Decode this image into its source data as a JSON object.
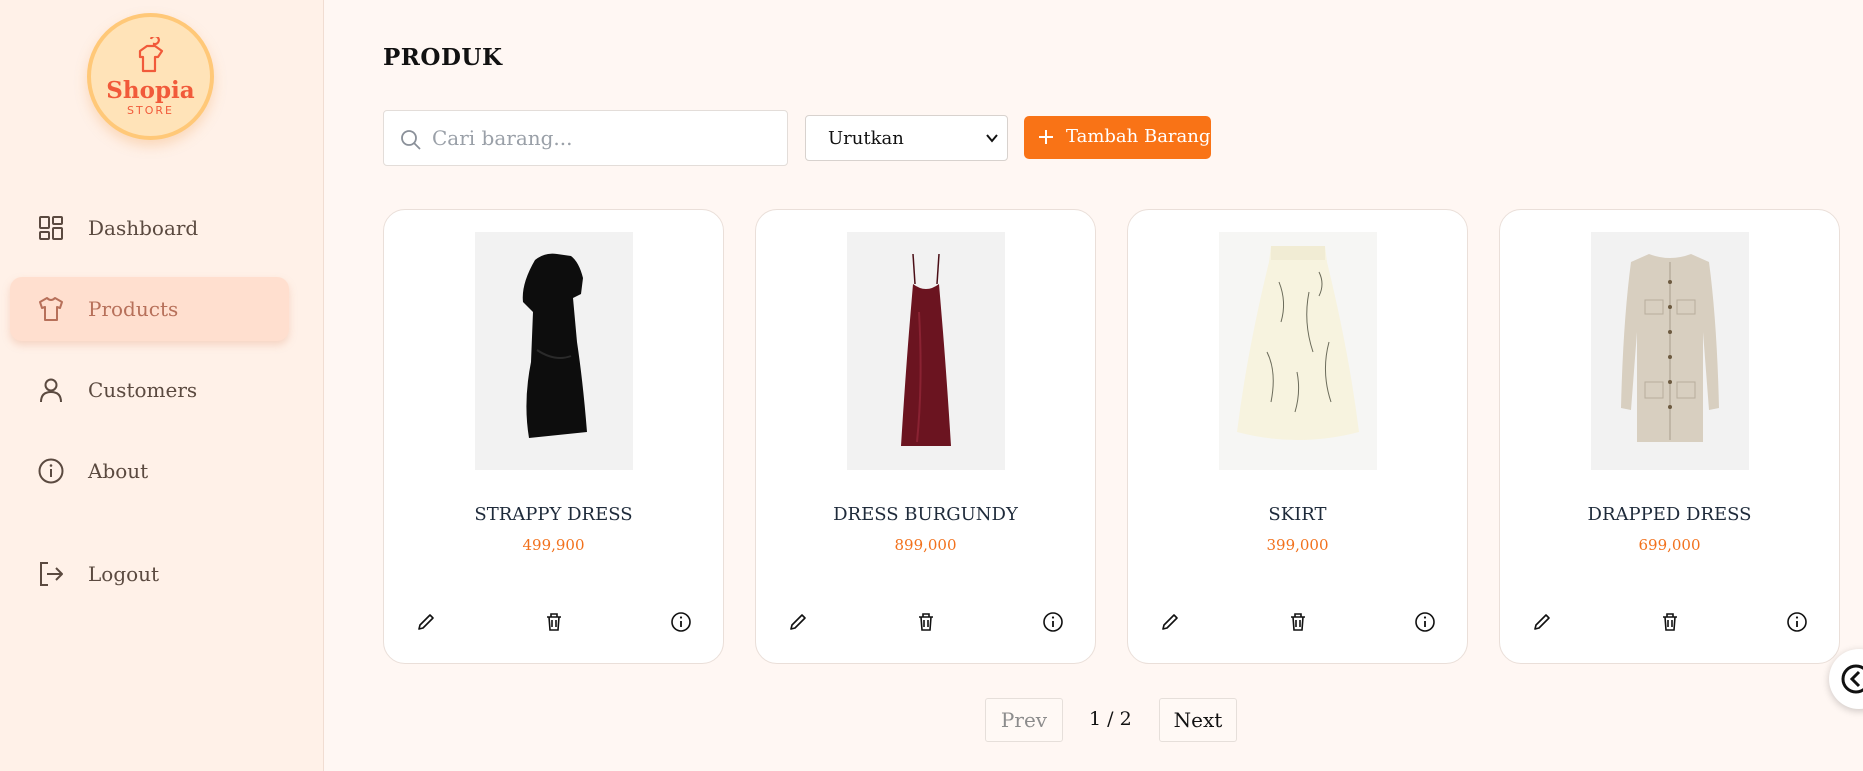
{
  "brand": {
    "name": "Shopia",
    "sub": "STORE",
    "accent": "#f15a3a"
  },
  "sidebar": {
    "items": [
      {
        "label": "Dashboard",
        "icon": "dashboard-grid-icon",
        "active": false
      },
      {
        "label": "Products",
        "icon": "tshirt-icon",
        "active": true
      },
      {
        "label": "Customers",
        "icon": "user-icon",
        "active": false
      },
      {
        "label": "About",
        "icon": "info-icon",
        "active": false
      },
      {
        "label": "Logout",
        "icon": "logout-icon",
        "active": false
      }
    ]
  },
  "main": {
    "title": "PRODUK",
    "search": {
      "placeholder": "Cari barang...",
      "value": ""
    },
    "sort": {
      "selected": "Urutkan"
    },
    "add_button": {
      "label": "Tambah Barang",
      "color": "#f97316"
    }
  },
  "products": [
    {
      "name": "STRAPPY DRESS",
      "price": "499,900",
      "image": "black-dress-icon"
    },
    {
      "name": "DRESS BURGUNDY",
      "price": "899,000",
      "image": "burgundy-slip-dress-icon"
    },
    {
      "name": "SKIRT",
      "price": "399,000",
      "image": "floral-skirt-icon"
    },
    {
      "name": "DRAPPED DRESS",
      "price": "699,000",
      "image": "beige-knit-dress-icon"
    }
  ],
  "pagination": {
    "prev": "Prev",
    "indicator": "1 / 2",
    "next": "Next"
  }
}
